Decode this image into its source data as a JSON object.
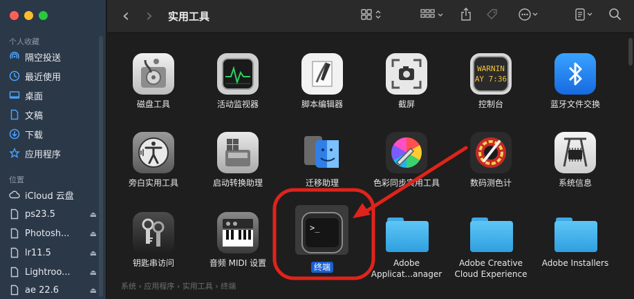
{
  "window": {
    "title": "实用工具"
  },
  "sidebar": {
    "favorites_title": "个人收藏",
    "favorites": [
      {
        "label": "隔空投送",
        "icon": "airdrop-icon"
      },
      {
        "label": "最近使用",
        "icon": "clock-icon"
      },
      {
        "label": "桌面",
        "icon": "desktop-icon"
      },
      {
        "label": "文稿",
        "icon": "document-icon"
      },
      {
        "label": "下载",
        "icon": "download-icon"
      },
      {
        "label": "应用程序",
        "icon": "applications-icon"
      }
    ],
    "locations_title": "位置",
    "locations": [
      {
        "label": "iCloud 云盘",
        "icon": "cloud-icon"
      },
      {
        "label": "ps23.5",
        "icon": "file-icon",
        "eject": "⏏"
      },
      {
        "label": "Photosh...",
        "icon": "file-icon",
        "eject": "⏏"
      },
      {
        "label": "lr11.5",
        "icon": "file-icon",
        "eject": "⏏"
      },
      {
        "label": "Lightroo...",
        "icon": "file-icon",
        "eject": "⏏"
      },
      {
        "label": "ae 22.6",
        "icon": "file-icon",
        "eject": "⏏"
      }
    ]
  },
  "toolbar": {
    "back": "‹",
    "forward": "›",
    "view_icon": "grid-view-icon",
    "group_icon": "group-by-icon",
    "share_icon": "share-icon",
    "tag_icon": "tag-icon",
    "action_icon": "more-actions-icon",
    "office_icon": "office-icon",
    "search_icon": "search-icon"
  },
  "items": [
    {
      "label": "磁盘工具",
      "icon": "disk-utility-icon"
    },
    {
      "label": "活动监视器",
      "icon": "activity-monitor-icon"
    },
    {
      "label": "脚本编辑器",
      "icon": "script-editor-icon"
    },
    {
      "label": "截屏",
      "icon": "screenshot-icon"
    },
    {
      "label": "控制台",
      "icon": "console-icon",
      "console_text": [
        "WARNIN",
        "AY 7:36"
      ]
    },
    {
      "label": "蓝牙文件交换",
      "icon": "bluetooth-icon"
    },
    {
      "label": "旁白实用工具",
      "icon": "voiceover-icon"
    },
    {
      "label": "启动转换助理",
      "icon": "boot-camp-icon"
    },
    {
      "label": "迁移助理",
      "icon": "migration-assistant-icon"
    },
    {
      "label": "色彩同步实用工具",
      "icon": "colorsync-icon"
    },
    {
      "label": "数码测色计",
      "icon": "digital-color-meter-icon"
    },
    {
      "label": "系统信息",
      "icon": "system-information-icon"
    },
    {
      "label": "钥匙串访问",
      "icon": "keychain-icon"
    },
    {
      "label": "音频 MIDI 设置",
      "icon": "audio-midi-icon"
    },
    {
      "label": "终端",
      "icon": "terminal-icon",
      "selected": true,
      "prompt": ">_"
    },
    {
      "label": "Adobe\nApplicat...anager",
      "icon": "folder-icon"
    },
    {
      "label": "Adobe Creative\nCloud Experience",
      "icon": "folder-icon"
    },
    {
      "label": "Adobe Installers",
      "icon": "folder-icon"
    }
  ],
  "pathbar": [
    "系统",
    "应用程序",
    "实用工具",
    "终端"
  ],
  "pathbar_sep": "›",
  "colors": {
    "selection": "#1a5fd1",
    "annotation": "#e0231b",
    "sidebar": "#2b3848"
  }
}
